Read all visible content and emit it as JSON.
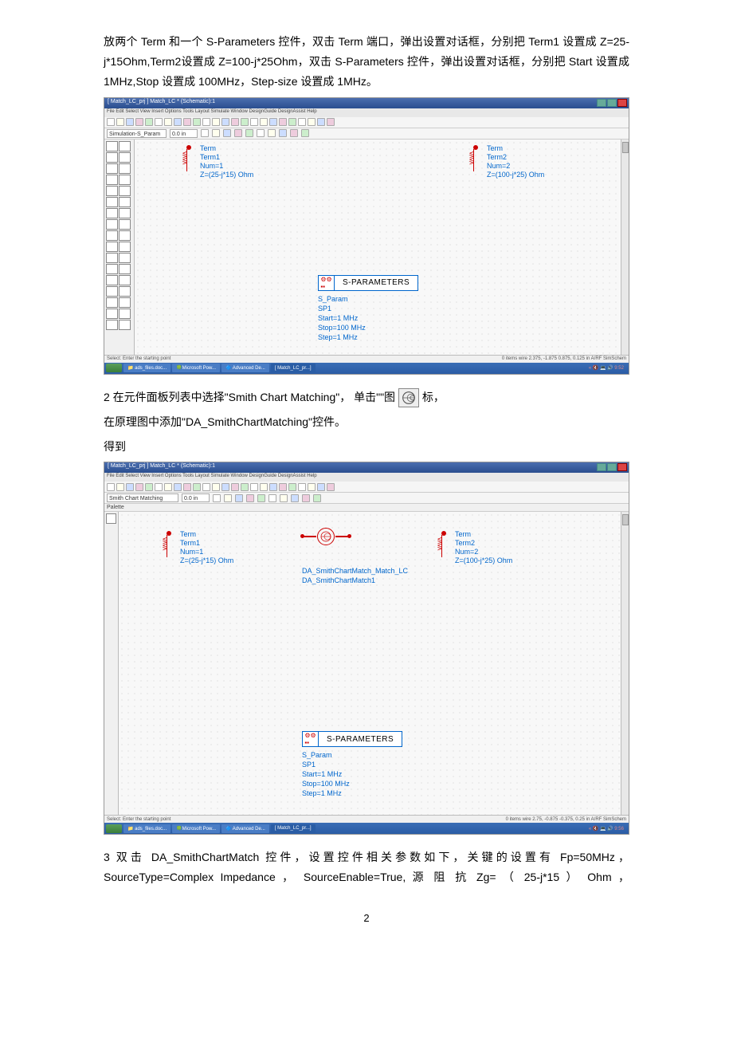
{
  "para_intro": "放两个 Term 和一个 S-Parameters 控件，双击 Term 端口，弹出设置对话框，分别把 Term1 设置成 Z=25-j*15Ohm,Term2设置成 Z=100-j*25Ohm，双击 S-Parameters 控件，弹出设置对话框，分别把 Start 设置成 1MHz,Stop 设置成 100MHz，Step-size 设置成 1MHz。",
  "shot1": {
    "title": "[ Match_LC_prj ] Match_LC * (Schematic):1",
    "menu": "File  Edit  Select  View  Insert  Options  Tools  Layout  Simulate  Window  DesignGuide  DesignAssist  Help",
    "dd_label": "Simulation-S_Param",
    "dd_val": "0.0 in",
    "term1": {
      "header": "Term",
      "name": "Term1",
      "num": "Num=1",
      "z": "Z=(25-j*15) Ohm"
    },
    "term2": {
      "header": "Term",
      "name": "Term2",
      "num": "Num=2",
      "z": "Z=(100-j*25) Ohm"
    },
    "sp": {
      "label": "S-PARAMETERS",
      "p1": "S_Param",
      "p2": "SP1",
      "p3": "Start=1 MHz",
      "p4": "Stop=100 MHz",
      "p5": "Step=1 MHz"
    },
    "status_l": "Select: Enter the starting point",
    "status_r": "0 items    wire    2.375, -1.875    0.875, 0.125    in    A/RF  SimSchem",
    "tasks": {
      "t1": "📁 ads_files.doc...",
      "t2": "🍀Microsoft Pow...",
      "t3": "🔷 Advanced De...",
      "t4": "[ Match_LC_pr...]"
    },
    "tray": "« 🔇 💻 🔊 9:52"
  },
  "para2_prefix": "2 在元件面板列表中选择\"Smith Chart Matching\"，   单击\"\"图",
  "para2_suffix": "标，",
  "para2_line2": "在原理图中添加\"DA_SmithChartMatching\"控件。",
  "para2_line3": "得到",
  "shot2": {
    "title": "[ Match_LC_prj ] Match_LC * (Schematic):1",
    "menu": "File  Edit  Select  View  Insert  Options  Tools  Layout  Simulate  Window  DesignGuide  DesignAssist  Help",
    "dd_label": "Smith Chart Matching",
    "dd_val": "0.0 in",
    "palette_hdr": "Palette",
    "term1": {
      "header": "Term",
      "name": "Term1",
      "num": "Num=1",
      "z": "Z=(25-j*15) Ohm"
    },
    "term2": {
      "header": "Term",
      "name": "Term2",
      "num": "Num=2",
      "z": "Z=(100-j*25) Ohm"
    },
    "da": {
      "line1": "DA_SmithChartMatch_Match_LC",
      "line2": "DA_SmithChartMatch1"
    },
    "sp": {
      "label": "S-PARAMETERS",
      "p1": "S_Param",
      "p2": "SP1",
      "p3": "Start=1 MHz",
      "p4": "Stop=100 MHz",
      "p5": "Step=1 MHz"
    },
    "status_l": "Select: Enter the starting point",
    "status_r": "0 items    wire    2.75, -0.875    -0.375, 0.25    in    A/RF  SimSchem",
    "tasks": {
      "t1": "📁 ads_files.doc...",
      "t2": "🍀Microsoft Pow...",
      "t3": "🔷 Advanced De...",
      "t4": "[ Match_LC_pr...]"
    },
    "tray": "« 🔇 💻 🔊 9:56"
  },
  "para3": "3 双击 DA_SmithChartMatch 控件，设置控件相关参数如下，关键的设置有 Fp=50MHz，SourceType=Complex Impedance ， SourceEnable=True, 源 阻 抗  Zg= （ 25-j*15 ） Ohm ，",
  "page_number": "2"
}
